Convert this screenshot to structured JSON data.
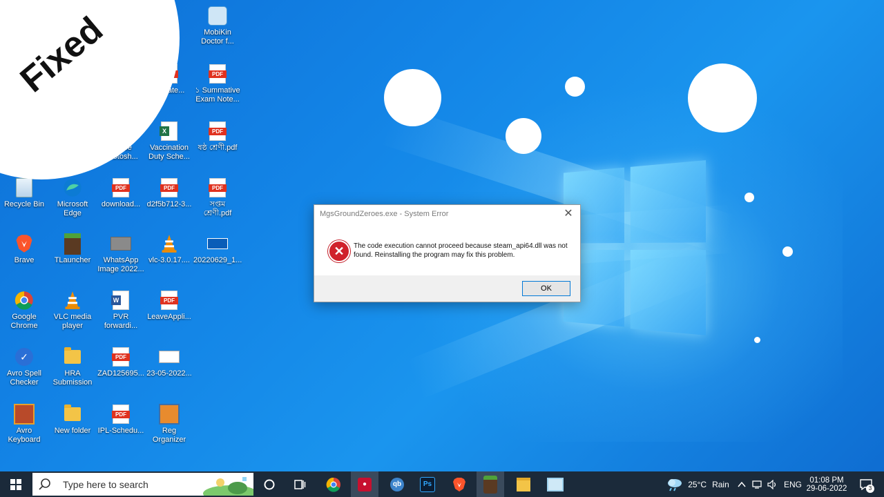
{
  "sticker": {
    "text": "Fixed"
  },
  "desktop_icons": [
    {
      "label": "Recycle Bin",
      "kind": "bin"
    },
    {
      "label": "Brave",
      "kind": "brave"
    },
    {
      "label": "Google\nChrome",
      "kind": "chrome"
    },
    {
      "label": "Avro Spell\nChecker",
      "kind": "avro"
    },
    {
      "label": "Avro\nKeyboard",
      "kind": "avrokb"
    },
    {
      "label": "Microsoft\nEdge",
      "kind": "edge"
    },
    {
      "label": "TLauncher",
      "kind": "tlauncher"
    },
    {
      "label": "VLC media\nplayer",
      "kind": "vlc"
    },
    {
      "label": "HRA\nSubmission",
      "kind": "folder"
    },
    {
      "label": "New folder",
      "kind": "folder"
    },
    {
      "label": "Adobe\nPhotosh...",
      "kind": "ps"
    },
    {
      "label": "download...",
      "kind": "pdf"
    },
    {
      "label": "WhatsApp\nImage 2022...",
      "kind": "image"
    },
    {
      "label": "PVR\nforwardi...",
      "kind": "word"
    },
    {
      "label": "ZAD125695...",
      "kind": "pdf"
    },
    {
      "label": "IPL-Schedu...",
      "kind": "pdf"
    },
    {
      "label": "e\nr",
      "kind": "partial"
    },
    {
      "label": "rtificate...",
      "kind": "pdf"
    },
    {
      "label": "Vaccination\nDuty Sche...",
      "kind": "excel"
    },
    {
      "label": "d2f5b712-3...",
      "kind": "pdf"
    },
    {
      "label": "vlc-3.0.17....",
      "kind": "vlc"
    },
    {
      "label": "LeaveAppli...",
      "kind": "pdf"
    },
    {
      "label": "23-05-2022...",
      "kind": "book"
    },
    {
      "label": "Reg\nOrganizer",
      "kind": "reg"
    },
    {
      "label": "MobiKin\nDoctor f...",
      "kind": "mobikin"
    },
    {
      "label": "১ Summative\nExam Note...",
      "kind": "pdf"
    },
    {
      "label": "ষষ্ঠ শ্রেণী.pdf",
      "kind": "pdf"
    },
    {
      "label": "সপ্তম\nশ্রেণী.pdf",
      "kind": "pdf"
    },
    {
      "label": "20220629_1...",
      "kind": "video"
    }
  ],
  "dialog": {
    "title": "MgsGroundZeroes.exe - System Error",
    "message": "The code execution cannot proceed because steam_api64.dll was not found. Reinstalling the program may fix this problem.",
    "ok_label": "OK",
    "close_glyph": "✕"
  },
  "taskbar": {
    "search_placeholder": "Type here to search",
    "weather_temp": "25°C",
    "weather_desc": "Rain",
    "language": "ENG",
    "time": "01:08 PM",
    "date": "29-06-2022",
    "notification_count": "3",
    "apps": [
      "cortana",
      "task-view",
      "chrome",
      "screen-recorder",
      "qbittorrent",
      "photoshop",
      "brave",
      "tlauncher",
      "file-explorer",
      "notepad"
    ]
  }
}
